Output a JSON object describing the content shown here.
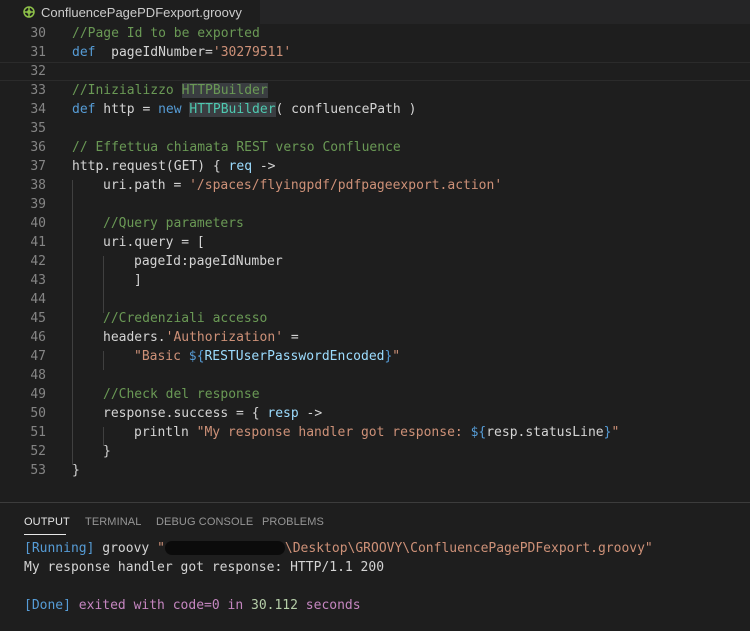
{
  "tab": {
    "filename": "ConfluencePagePDFexport.groovy",
    "icon": "groovy-file-icon"
  },
  "lines": [
    {
      "n": "30",
      "segs": [
        [
          "c-com",
          "//Page Id to be exported"
        ]
      ],
      "indent": 0
    },
    {
      "n": "31",
      "segs": [
        [
          "c-kw",
          "def"
        ],
        [
          "",
          "  pageIdNumber="
        ],
        [
          "c-str",
          "'30279511'"
        ]
      ],
      "indent": 0
    },
    {
      "n": "32",
      "segs": [],
      "indent": 0,
      "current": true
    },
    {
      "n": "33",
      "segs": [
        [
          "c-com",
          "//Inizializzo HTTPBuilder"
        ]
      ],
      "indent": 0
    },
    {
      "n": "34",
      "segs": [
        [
          "c-kw",
          "def"
        ],
        [
          "",
          " http = "
        ],
        [
          "c-kw",
          "new"
        ],
        [
          "",
          " "
        ],
        [
          "c-cls",
          "HTTPBuilder"
        ],
        [
          "",
          "( confluencePath )"
        ]
      ],
      "indent": 0
    },
    {
      "n": "35",
      "segs": [],
      "indent": 0
    },
    {
      "n": "36",
      "segs": [
        [
          "c-com",
          "// Effettua chiamata REST verso Confluence"
        ]
      ],
      "indent": 0
    },
    {
      "n": "37",
      "segs": [
        [
          "",
          "http.request(GET) { "
        ],
        [
          "c-var",
          "req"
        ],
        [
          "",
          " ->"
        ]
      ],
      "indent": 0
    },
    {
      "n": "38",
      "segs": [
        [
          "",
          "uri.path = "
        ],
        [
          "c-str",
          "'/spaces/flyingpdf/pdfpageexport.action'"
        ]
      ],
      "indent": 1
    },
    {
      "n": "39",
      "segs": [],
      "indent": 0
    },
    {
      "n": "40",
      "segs": [
        [
          "c-com",
          "//Query parameters"
        ]
      ],
      "indent": 1
    },
    {
      "n": "41",
      "segs": [
        [
          "",
          "uri.query = ["
        ]
      ],
      "indent": 1
    },
    {
      "n": "42",
      "segs": [
        [
          "",
          "pageId:pageIdNumber"
        ]
      ],
      "indent": 2
    },
    {
      "n": "43",
      "segs": [
        [
          "",
          "]"
        ]
      ],
      "indent": 2
    },
    {
      "n": "44",
      "segs": [],
      "indent": 0
    },
    {
      "n": "45",
      "segs": [
        [
          "c-com",
          "//Credenziali accesso"
        ]
      ],
      "indent": 1
    },
    {
      "n": "46",
      "segs": [
        [
          "",
          "headers."
        ],
        [
          "c-str",
          "'Authorization'"
        ],
        [
          "",
          " ="
        ]
      ],
      "indent": 1
    },
    {
      "n": "47",
      "segs": [
        [
          "c-str",
          "\"Basic "
        ],
        [
          "c-kw",
          "${"
        ],
        [
          "c-var",
          "RESTUserPasswordEncoded"
        ],
        [
          "c-kw",
          "}"
        ],
        [
          "c-str",
          "\""
        ]
      ],
      "indent": 2
    },
    {
      "n": "48",
      "segs": [],
      "indent": 0
    },
    {
      "n": "49",
      "segs": [
        [
          "c-com",
          "//Check del response"
        ]
      ],
      "indent": 1
    },
    {
      "n": "50",
      "segs": [
        [
          "",
          "response.success = { "
        ],
        [
          "c-var",
          "resp"
        ],
        [
          "",
          " ->"
        ]
      ],
      "indent": 1
    },
    {
      "n": "51",
      "segs": [
        [
          "",
          "println "
        ],
        [
          "c-str",
          "\"My response handler got response: "
        ],
        [
          "c-kw",
          "${"
        ],
        [
          "",
          "resp.statusLine"
        ],
        [
          "c-kw",
          "}"
        ],
        [
          "c-str",
          "\""
        ]
      ],
      "indent": 2
    },
    {
      "n": "52",
      "segs": [
        [
          "",
          "}"
        ]
      ],
      "indent": 1
    },
    {
      "n": "53",
      "segs": [
        [
          "",
          "}"
        ]
      ],
      "indent": 0
    }
  ],
  "panel": {
    "tabs": [
      "OUTPUT",
      "TERMINAL",
      "DEBUG CONSOLE",
      "PROBLEMS"
    ],
    "active_tab": "OUTPUT",
    "output": {
      "running_tag": "[Running]",
      "running_cmd": " groovy ",
      "path_quote_open": "\"",
      "path_rest": "\\Desktop\\GROOVY\\ConfluencePagePDFexport.groovy\"",
      "response_line": "My response handler got response: HTTP/1.1 200",
      "done_tag": "[Done]",
      "done_text_1": " exited with ",
      "done_code": "code=0",
      "done_text_2": " in ",
      "done_seconds": "30.112",
      "done_text_3": " seconds"
    }
  }
}
